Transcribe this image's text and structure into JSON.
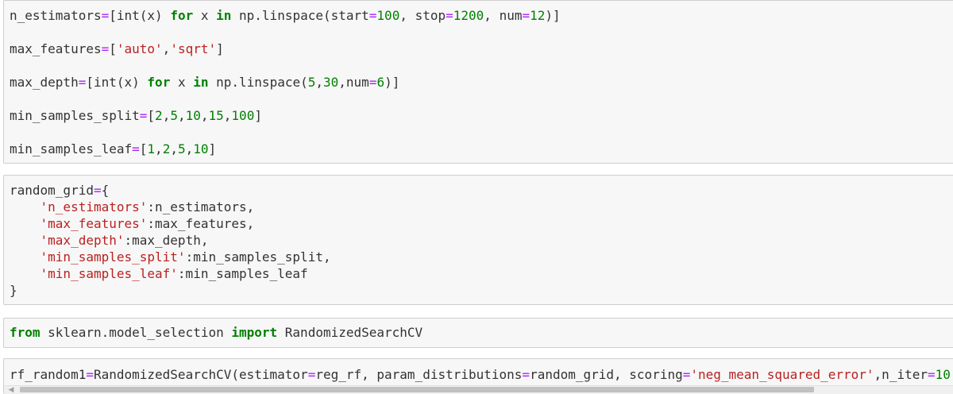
{
  "cells": [
    {
      "lines": [
        [
          {
            "t": "nm",
            "v": "n_estimators"
          },
          {
            "t": "op",
            "v": "="
          },
          {
            "t": "nm",
            "v": "["
          },
          {
            "t": "nm",
            "v": "int"
          },
          {
            "t": "nm",
            "v": "(x) "
          },
          {
            "t": "kw",
            "v": "for"
          },
          {
            "t": "nm",
            "v": " x "
          },
          {
            "t": "kw",
            "v": "in"
          },
          {
            "t": "nm",
            "v": " np.linspace(start"
          },
          {
            "t": "op",
            "v": "="
          },
          {
            "t": "num",
            "v": "100"
          },
          {
            "t": "nm",
            "v": ", stop"
          },
          {
            "t": "op",
            "v": "="
          },
          {
            "t": "num",
            "v": "1200"
          },
          {
            "t": "nm",
            "v": ", num"
          },
          {
            "t": "op",
            "v": "="
          },
          {
            "t": "num",
            "v": "12"
          },
          {
            "t": "nm",
            "v": ")]"
          }
        ],
        [],
        [
          {
            "t": "nm",
            "v": "max_features"
          },
          {
            "t": "op",
            "v": "="
          },
          {
            "t": "nm",
            "v": "["
          },
          {
            "t": "str",
            "v": "'auto'"
          },
          {
            "t": "nm",
            "v": ","
          },
          {
            "t": "str",
            "v": "'sqrt'"
          },
          {
            "t": "nm",
            "v": "]"
          }
        ],
        [],
        [
          {
            "t": "nm",
            "v": "max_depth"
          },
          {
            "t": "op",
            "v": "="
          },
          {
            "t": "nm",
            "v": "["
          },
          {
            "t": "nm",
            "v": "int"
          },
          {
            "t": "nm",
            "v": "(x) "
          },
          {
            "t": "kw",
            "v": "for"
          },
          {
            "t": "nm",
            "v": " x "
          },
          {
            "t": "kw",
            "v": "in"
          },
          {
            "t": "nm",
            "v": " np.linspace("
          },
          {
            "t": "num",
            "v": "5"
          },
          {
            "t": "nm",
            "v": ","
          },
          {
            "t": "num",
            "v": "30"
          },
          {
            "t": "nm",
            "v": ",num"
          },
          {
            "t": "op",
            "v": "="
          },
          {
            "t": "num",
            "v": "6"
          },
          {
            "t": "nm",
            "v": ")]"
          }
        ],
        [],
        [
          {
            "t": "nm",
            "v": "min_samples_split"
          },
          {
            "t": "op",
            "v": "="
          },
          {
            "t": "nm",
            "v": "["
          },
          {
            "t": "num",
            "v": "2"
          },
          {
            "t": "nm",
            "v": ","
          },
          {
            "t": "num",
            "v": "5"
          },
          {
            "t": "nm",
            "v": ","
          },
          {
            "t": "num",
            "v": "10"
          },
          {
            "t": "nm",
            "v": ","
          },
          {
            "t": "num",
            "v": "15"
          },
          {
            "t": "nm",
            "v": ","
          },
          {
            "t": "num",
            "v": "100"
          },
          {
            "t": "nm",
            "v": "]"
          }
        ],
        [],
        [
          {
            "t": "nm",
            "v": "min_samples_leaf"
          },
          {
            "t": "op",
            "v": "="
          },
          {
            "t": "nm",
            "v": "["
          },
          {
            "t": "num",
            "v": "1"
          },
          {
            "t": "nm",
            "v": ","
          },
          {
            "t": "num",
            "v": "2"
          },
          {
            "t": "nm",
            "v": ","
          },
          {
            "t": "num",
            "v": "5"
          },
          {
            "t": "nm",
            "v": ","
          },
          {
            "t": "num",
            "v": "10"
          },
          {
            "t": "nm",
            "v": "]"
          }
        ]
      ]
    },
    {
      "lines": [
        [
          {
            "t": "nm",
            "v": "random_grid"
          },
          {
            "t": "op",
            "v": "="
          },
          {
            "t": "nm",
            "v": "{"
          }
        ],
        [
          {
            "t": "nm",
            "v": "    "
          },
          {
            "t": "str",
            "v": "'n_estimators'"
          },
          {
            "t": "nm",
            "v": ":n_estimators,"
          }
        ],
        [
          {
            "t": "nm",
            "v": "    "
          },
          {
            "t": "str",
            "v": "'max_features'"
          },
          {
            "t": "nm",
            "v": ":max_features,"
          }
        ],
        [
          {
            "t": "nm",
            "v": "    "
          },
          {
            "t": "str",
            "v": "'max_depth'"
          },
          {
            "t": "nm",
            "v": ":max_depth,"
          }
        ],
        [
          {
            "t": "nm",
            "v": "    "
          },
          {
            "t": "str",
            "v": "'min_samples_split'"
          },
          {
            "t": "nm",
            "v": ":min_samples_split,"
          }
        ],
        [
          {
            "t": "nm",
            "v": "    "
          },
          {
            "t": "str",
            "v": "'min_samples_leaf'"
          },
          {
            "t": "nm",
            "v": ":min_samples_leaf"
          }
        ],
        [
          {
            "t": "nm",
            "v": "}"
          }
        ]
      ]
    },
    {
      "lines": [
        [
          {
            "t": "kw",
            "v": "from"
          },
          {
            "t": "nm",
            "v": " sklearn.model_selection "
          },
          {
            "t": "kw",
            "v": "import"
          },
          {
            "t": "nm",
            "v": " RandomizedSearchCV"
          }
        ]
      ]
    },
    {
      "lines": [
        [
          {
            "t": "nm",
            "v": "rf_random1"
          },
          {
            "t": "op",
            "v": "="
          },
          {
            "t": "nm",
            "v": "RandomizedSearchCV(estimator"
          },
          {
            "t": "op",
            "v": "="
          },
          {
            "t": "nm",
            "v": "reg_rf, param_distributions"
          },
          {
            "t": "op",
            "v": "="
          },
          {
            "t": "nm",
            "v": "random_grid, scoring"
          },
          {
            "t": "op",
            "v": "="
          },
          {
            "t": "str",
            "v": "'neg_mean_squared_error'"
          },
          {
            "t": "nm",
            "v": ",n_iter"
          },
          {
            "t": "op",
            "v": "="
          },
          {
            "t": "num",
            "v": "10"
          },
          {
            "t": "nm",
            "v": ","
          }
        ]
      ]
    }
  ]
}
